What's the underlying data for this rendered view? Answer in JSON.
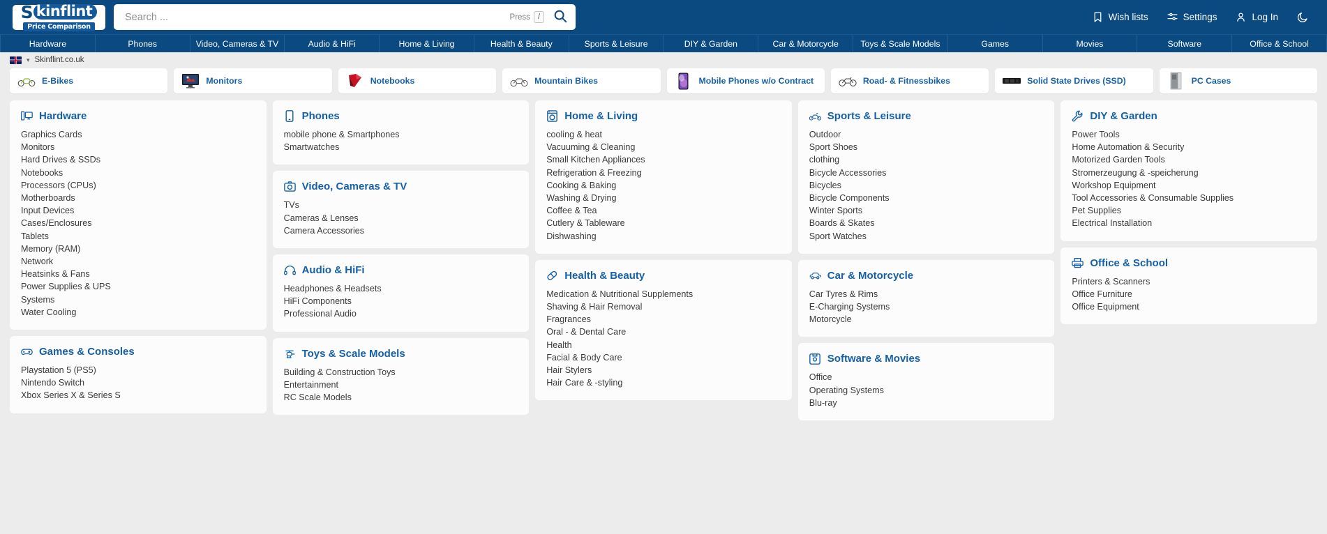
{
  "brand": {
    "logo_s": "S",
    "logo_word": "kinflint",
    "logo_tagline": "Price Comparison"
  },
  "search": {
    "placeholder": "Search ...",
    "value": "",
    "press_label": "Press",
    "key": "/",
    "icon": "search-icon"
  },
  "topbar_links": [
    {
      "label": "Wish lists",
      "icon": "bookmark-icon"
    },
    {
      "label": "Settings",
      "icon": "sliders-icon"
    },
    {
      "label": "Log In",
      "icon": "user-icon"
    },
    {
      "label": "",
      "icon": "moon-icon"
    }
  ],
  "nav": [
    "Hardware",
    "Phones",
    "Video, Cameras & TV",
    "Audio & HiFi",
    "Home & Living",
    "Health & Beauty",
    "Sports & Leisure",
    "DIY & Garden",
    "Car & Motorcycle",
    "Toys & Scale Models",
    "Games",
    "Movies",
    "Software",
    "Office & School"
  ],
  "breadcrumb": {
    "flag": "uk-flag-icon",
    "caret": "chevron-down-icon",
    "site": "Skinflint.co.uk"
  },
  "tiles": [
    {
      "label": "E-Bikes",
      "icon": "ebike-thumb"
    },
    {
      "label": "Monitors",
      "icon": "monitor-thumb"
    },
    {
      "label": "Notebooks",
      "icon": "notebook-thumb"
    },
    {
      "label": "Mountain Bikes",
      "icon": "mountainbike-thumb"
    },
    {
      "label": "Mobile Phones w/o Contract",
      "icon": "phone-thumb"
    },
    {
      "label": "Road- & Fitnessbikes",
      "icon": "roadbike-thumb"
    },
    {
      "label": "Solid State Drives (SSD)",
      "icon": "ssd-thumb"
    },
    {
      "label": "PC Cases",
      "icon": "pccase-thumb"
    }
  ],
  "columns": [
    {
      "cards": [
        {
          "title": "Hardware",
          "icon": "desktop-icon",
          "items": [
            "Graphics Cards",
            "Monitors",
            "Hard Drives & SSDs",
            "Notebooks",
            "Processors (CPUs)",
            "Motherboards",
            "Input Devices",
            "Cases/Enclosures",
            "Tablets",
            "Memory (RAM)",
            "Network",
            "Heatsinks & Fans",
            "Power Supplies & UPS",
            "Systems",
            "Water Cooling"
          ]
        },
        {
          "title": "Games & Consoles",
          "icon": "gamepad-icon",
          "items": [
            "Playstation 5 (PS5)",
            "Nintendo Switch",
            "Xbox Series X & Series S"
          ]
        }
      ]
    },
    {
      "cards": [
        {
          "title": "Phones",
          "icon": "mobile-icon",
          "items": [
            "mobile phone & Smartphones",
            "Smartwatches"
          ]
        },
        {
          "title": "Video, Cameras & TV",
          "icon": "camera-icon",
          "items": [
            "TVs",
            "Cameras & Lenses",
            "Camera Accessories"
          ]
        },
        {
          "title": "Audio & HiFi",
          "icon": "headphones-icon",
          "items": [
            "Headphones & Headsets",
            "HiFi Components",
            "Professional Audio"
          ]
        },
        {
          "title": "Toys & Scale Models",
          "icon": "helicopter-icon",
          "items": [
            "Building & Construction Toys",
            "Entertainment",
            "RC Scale Models"
          ]
        }
      ]
    },
    {
      "cards": [
        {
          "title": "Home & Living",
          "icon": "washer-icon",
          "items": [
            "cooling & heat",
            "Vacuuming & Cleaning",
            "Small Kitchen Appliances",
            "Refrigeration & Freezing",
            "Cooking & Baking",
            "Washing & Drying",
            "Coffee & Tea",
            "Cutlery & Tableware",
            "Dishwashing"
          ]
        },
        {
          "title": "Health & Beauty",
          "icon": "pill-icon",
          "items": [
            "Medication & Nutritional Supplements",
            "Shaving & Hair Removal",
            "Fragrances",
            "Oral - & Dental Care",
            "Health",
            "Facial & Body Care",
            "Hair Stylers",
            "Hair Care & -styling"
          ]
        }
      ]
    },
    {
      "cards": [
        {
          "title": "Sports & Leisure",
          "icon": "bicycle-icon",
          "items": [
            "Outdoor",
            "Sport Shoes",
            "clothing",
            "Bicycle Accessories",
            "Bicycles",
            "Bicycle Components",
            "Winter Sports",
            "Boards & Skates",
            "Sport Watches"
          ]
        },
        {
          "title": "Car & Motorcycle",
          "icon": "car-icon",
          "items": [
            "Car Tyres & Rims",
            "E-Charging Systems",
            "Motorcycle"
          ]
        },
        {
          "title": "Software & Movies",
          "icon": "floppy-icon",
          "items": [
            "Office",
            "Operating Systems",
            "Blu-ray"
          ]
        }
      ]
    },
    {
      "cards": [
        {
          "title": "DIY & Garden",
          "icon": "wrench-icon",
          "items": [
            "Power Tools",
            "Home Automation & Security",
            "Motorized Garden Tools",
            "Stromerzeugung & -speicherung",
            "Workshop Equipment",
            "Tool Accessories & Consumable Supplies",
            "Pet Supplies",
            "Electrical Installation"
          ]
        },
        {
          "title": "Office & School",
          "icon": "printer-icon",
          "items": [
            "Printers & Scanners",
            "Office Furniture",
            "Office Equipment"
          ]
        }
      ]
    }
  ],
  "colors": {
    "brand_blue": "#0b4a80",
    "link_blue": "#1560a8",
    "page_bg": "#ececec",
    "card_bg": "#fcfcfc"
  }
}
